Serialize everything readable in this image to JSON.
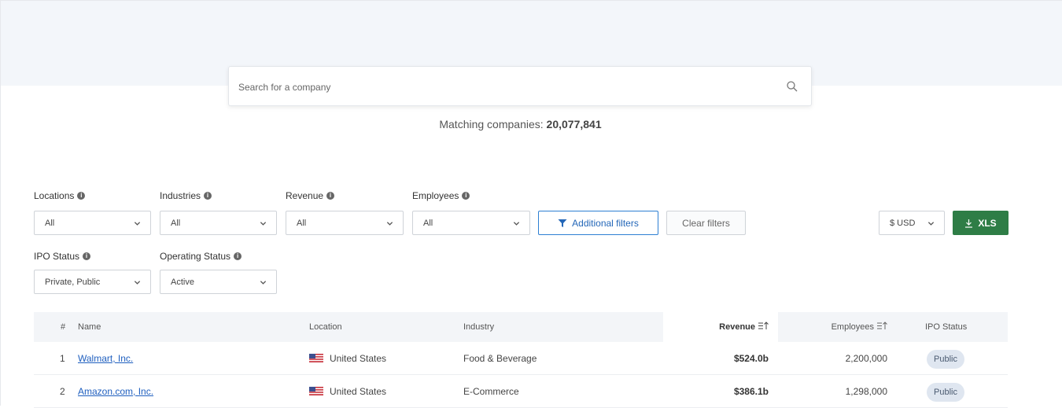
{
  "search": {
    "placeholder": "Search for a company"
  },
  "matching": {
    "prefix": "Matching companies: ",
    "count": "20,077,841"
  },
  "filters": {
    "locations": {
      "label": "Locations",
      "value": "All"
    },
    "industries": {
      "label": "Industries",
      "value": "All"
    },
    "revenue": {
      "label": "Revenue",
      "value": "All"
    },
    "employees": {
      "label": "Employees",
      "value": "All"
    },
    "ipo_status": {
      "label": "IPO Status",
      "value": "Private, Public"
    },
    "operating_status": {
      "label": "Operating Status",
      "value": "Active"
    }
  },
  "buttons": {
    "additional_filters": "Additional filters",
    "clear_filters": "Clear filters",
    "currency": "$ USD",
    "xls": "XLS"
  },
  "table": {
    "columns": {
      "rank": "#",
      "name": "Name",
      "location": "Location",
      "industry": "Industry",
      "revenue": "Revenue",
      "employees": "Employees",
      "ipo_status": "IPO Status"
    },
    "rows": [
      {
        "rank": "1",
        "name": "Walmart, Inc.",
        "location": "United States",
        "industry": "Food & Beverage",
        "revenue": "$524.0b",
        "employees": "2,200,000",
        "ipo_status": "Public"
      },
      {
        "rank": "2",
        "name": "Amazon.com, Inc.",
        "location": "United States",
        "industry": "E-Commerce",
        "revenue": "$386.1b",
        "employees": "1,298,000",
        "ipo_status": "Public"
      }
    ]
  },
  "icons": {
    "search": "search-icon",
    "info": "info-icon",
    "chevron": "chevron-down-icon",
    "filter": "filter-icon",
    "download": "download-icon",
    "sort": "sort-icon",
    "flag": "us-flag-icon"
  },
  "colors": {
    "accent": "#2d7fd3",
    "xls_button": "#2e7d46",
    "link": "#1f5fbf",
    "badge": "#dfe6f0"
  }
}
